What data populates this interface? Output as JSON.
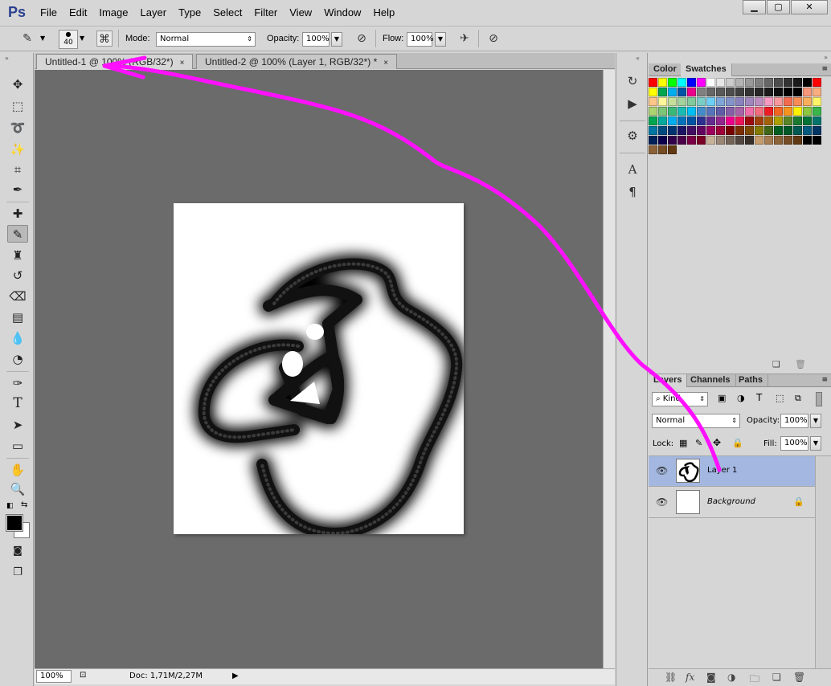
{
  "app": {
    "logo": "Ps"
  },
  "menu": [
    "File",
    "Edit",
    "Image",
    "Layer",
    "Type",
    "Select",
    "Filter",
    "View",
    "Window",
    "Help"
  ],
  "window_controls": {
    "minimize": "▁",
    "maximize": "▢",
    "close": "✕"
  },
  "options": {
    "brush_size": "40",
    "mode_label": "Mode:",
    "mode_value": "Normal",
    "opacity_label": "Opacity:",
    "opacity_value": "100%",
    "flow_label": "Flow:",
    "flow_value": "100%"
  },
  "tabs": [
    {
      "label": "Untitled-1 @ 100% (RGB/32*)",
      "close": "×"
    },
    {
      "label": "Untitled-2 @ 100% (Layer 1, RGB/32*) *",
      "close": "×"
    }
  ],
  "status": {
    "zoom": "100%",
    "doc": "Doc: 1,71M/2,27M"
  },
  "swatch_panel": {
    "tab_color": "Color",
    "tab_swatches": "Swatches"
  },
  "swatch_colors": [
    [
      "#ff0000",
      "#ffff00",
      "#00ff00",
      "#00ffff",
      "#0000ff",
      "#ff00ff",
      "#ffffff",
      "#e6e6e6",
      "#cccccc",
      "#b3b3b3",
      "#999999",
      "#808080",
      "#666666",
      "#4d4d4d",
      "#333333",
      "#1a1a1a",
      "#000000",
      "#ff0000"
    ],
    [
      "#ffff00",
      "#00a650",
      "#00aeef",
      "#0054a6",
      "#ec008c",
      "#808080",
      "#666666",
      "#595959",
      "#4d4d4d",
      "#404040",
      "#333333",
      "#262626",
      "#1a1a1a",
      "#0d0d0d",
      "#000000",
      "#000000",
      "#f7977a",
      "#f9ad81"
    ],
    [
      "#fdc68a",
      "#fff79a",
      "#c4df9b",
      "#a3d39c",
      "#82ca9d",
      "#7bcdc8",
      "#6ecff6",
      "#7ea7d8",
      "#8493ca",
      "#8882be",
      "#a187be",
      "#bc8dbf",
      "#f49ac2",
      "#f6989d",
      "#f26c4f",
      "#f68e56",
      "#fbaf5d",
      "#fff568"
    ],
    [
      "#acd372",
      "#7cc576",
      "#3bb878",
      "#1abbb4",
      "#00bff3",
      "#438ccb",
      "#5574b9",
      "#605ca8",
      "#855fa8",
      "#a763a8",
      "#f06eaa",
      "#f26d7d",
      "#ed1c24",
      "#f26522",
      "#f7941d",
      "#fff200",
      "#8dc63f",
      "#39b54a"
    ],
    [
      "#00a651",
      "#00a99d",
      "#00aeef",
      "#0072bc",
      "#0054a6",
      "#2e3192",
      "#662d91",
      "#92278f",
      "#ec008c",
      "#ed145b",
      "#9e0b0f",
      "#a0410d",
      "#a36209",
      "#aba000",
      "#598527",
      "#1a7b30",
      "#007236",
      "#00746b"
    ],
    [
      "#0076a3",
      "#004b80",
      "#003471",
      "#1b1464",
      "#440e62",
      "#630460",
      "#9e005d",
      "#9e0039",
      "#790000",
      "#7b2e00",
      "#7d4900",
      "#827b00",
      "#406618",
      "#005e20",
      "#005826",
      "#005952",
      "#005b7f",
      "#003663"
    ],
    [
      "#002157",
      "#0d004c",
      "#32004b",
      "#4b0049",
      "#7b0046",
      "#7a0026",
      "#c7b299",
      "#998675",
      "#736357",
      "#534741",
      "#37302a",
      "#c69c6d",
      "#a67c52",
      "#8c6239",
      "#754c24",
      "#603913",
      "#000000",
      "#000000"
    ],
    [
      "#8c6239",
      "#754c24",
      "#603913"
    ]
  ],
  "layers_panel": {
    "tab_layers": "Layers",
    "tab_channels": "Channels",
    "tab_paths": "Paths",
    "filter_kind": "Kind",
    "blend_mode": "Normal",
    "opacity_label": "Opacity:",
    "opacity_value": "100%",
    "lock_label": "Lock:",
    "fill_label": "Fill:",
    "fill_value": "100%",
    "layers": [
      {
        "name": "Layer 1",
        "selected": true
      },
      {
        "name": "Background",
        "selected": false
      }
    ]
  }
}
